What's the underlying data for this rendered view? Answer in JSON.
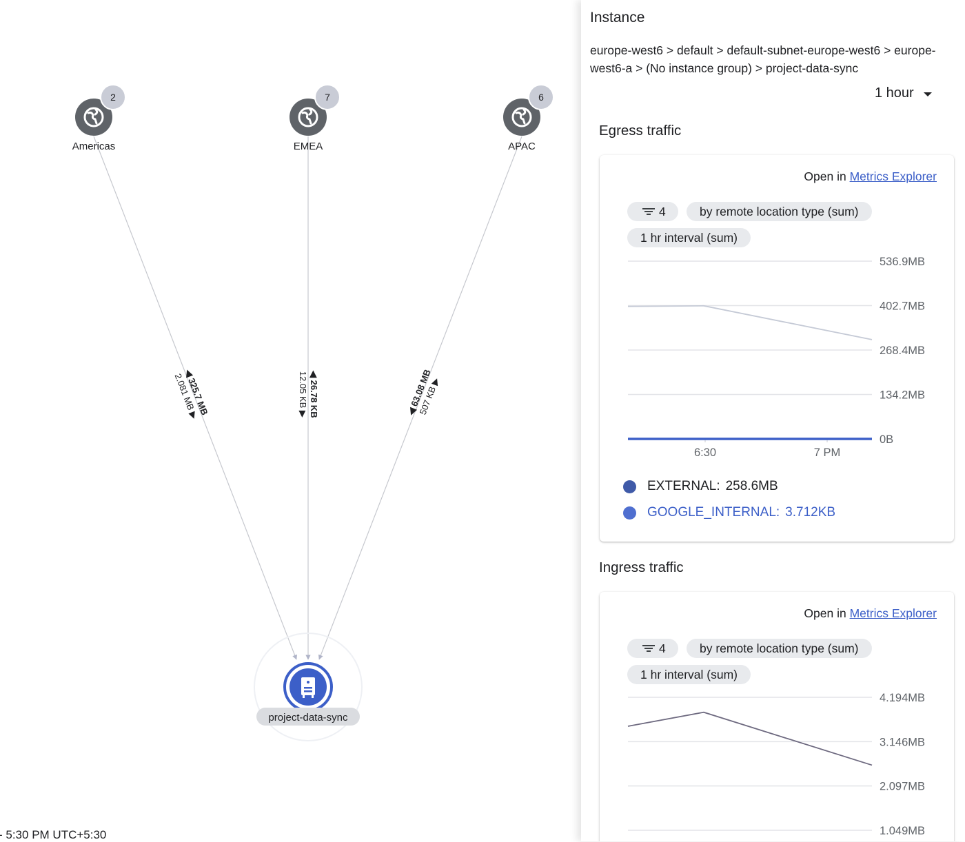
{
  "topology": {
    "regions": [
      {
        "label": "Americas",
        "count": "2",
        "egress": "325.7 MB",
        "ingress": "2.081 MB"
      },
      {
        "label": "EMEA",
        "count": "7",
        "egress": "26.78 KB",
        "ingress": "12.05 KB"
      },
      {
        "label": "APAC",
        "count": "6",
        "egress": "63.08 MB",
        "ingress": "507 KB"
      }
    ],
    "instance_label": "project-data-sync",
    "time_footer": "- 5:30 PM UTC+5:30"
  },
  "panel": {
    "title": "Instance",
    "breadcrumb": "europe-west6 > default > default-subnet-europe-west6 > europe-west6-a > (No instance group) > project-data-sync",
    "time_range": "1 hour"
  },
  "egress": {
    "title": "Egress traffic",
    "open_in_prefix": "Open in",
    "open_in_link": "Metrics Explorer",
    "filter_count": "4",
    "group_chip": "by remote location type (sum)",
    "interval_chip": "1 hr interval (sum)",
    "chart_data": {
      "type": "line",
      "x": [
        "6:15",
        "6:30",
        "7 PM"
      ],
      "x_tick_labels": [
        "6:30",
        "7 PM"
      ],
      "y_tick_labels": [
        "536.9MB",
        "402.7MB",
        "268.4MB",
        "134.2MB",
        "0B"
      ],
      "ylim": [
        0,
        536.9
      ],
      "y_unit": "MB",
      "series": [
        {
          "name": "EXTERNAL",
          "values": [
            400,
            402,
            300
          ],
          "color": "#c5cad6"
        },
        {
          "name": "GOOGLE_INTERNAL",
          "values": [
            0,
            0,
            0
          ],
          "color": "#3c5fc8"
        }
      ]
    },
    "legend": [
      {
        "name": "EXTERNAL",
        "value": "258.6MB",
        "color": "#3f5aa8",
        "text_color": "#202124"
      },
      {
        "name": "GOOGLE_INTERNAL",
        "value": "3.712KB",
        "color": "#4f6fd0",
        "text_color": "#3c5fc8"
      }
    ]
  },
  "ingress": {
    "title": "Ingress traffic",
    "open_in_prefix": "Open in",
    "open_in_link": "Metrics Explorer",
    "filter_count": "4",
    "group_chip": "by remote location type (sum)",
    "interval_chip": "1 hr interval (sum)",
    "chart_data": {
      "type": "line",
      "x": [
        "6:15",
        "6:30",
        "7 PM"
      ],
      "y_tick_labels": [
        "4.194MB",
        "3.146MB",
        "2.097MB",
        "1.049MB"
      ],
      "ylim": [
        1.049,
        4.194
      ],
      "y_unit": "MB",
      "series": [
        {
          "name": "",
          "values": [
            3.51,
            3.84,
            2.59
          ],
          "color": "#6e6a80"
        }
      ]
    }
  }
}
